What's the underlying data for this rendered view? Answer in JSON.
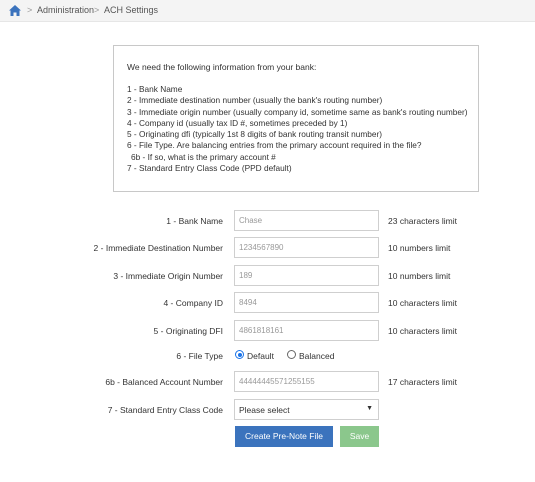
{
  "breadcrumb": {
    "items": [
      "Administration",
      "ACH Settings"
    ],
    "separator": ">"
  },
  "info": {
    "intro": "We need the following information from your bank:",
    "lines": [
      "1 - Bank Name",
      "2 - Immediate destination number (usually the bank's routing number)",
      "3 - Immediate origin number (usually company id, sometime same as bank's routing number)",
      "4 - Company id (usually tax ID #, sometimes preceded by 1)",
      "5 - Originating dfi (typically 1st 8 digits of bank routing transit number)",
      "6 - File Type. Are balancing entries from the primary account required in the file?",
      " 6b - If so, what is the primary account #",
      "7 - Standard Entry Class Code (PPD default)"
    ]
  },
  "form": {
    "bank_name": {
      "label": "1 - Bank Name",
      "placeholder": "Chase",
      "hint": "23 characters limit"
    },
    "immediate_destination": {
      "label": "2 - Immediate Destination Number",
      "placeholder": "1234567890",
      "hint": "10 numbers limit"
    },
    "immediate_origin": {
      "label": "3 - Immediate Origin Number",
      "placeholder": "189",
      "hint": "10 numbers limit"
    },
    "company_id": {
      "label": "4 - Company ID",
      "placeholder": "8494",
      "hint": "10 characters limit"
    },
    "originating_dfi": {
      "label": "5 - Originating DFI",
      "placeholder": "4861818161",
      "hint": "10 characters limit"
    },
    "file_type": {
      "label": "6 - File Type",
      "options": [
        "Default",
        "Balanced"
      ],
      "selected": "Default"
    },
    "balanced_account": {
      "label": "6b - Balanced Account Number",
      "placeholder": "44444445571255155",
      "hint": "17 characters limit"
    },
    "sec_code": {
      "label": "7 - Standard Entry Class Code",
      "value": "Please select"
    }
  },
  "buttons": {
    "prenote": "Create Pre-Note File",
    "save": "Save"
  },
  "colors": {
    "primary_button": "#3b73bd",
    "save_button": "#8bc78c",
    "radio_accent": "#1a73e8",
    "home_icon": "#3b73bd"
  }
}
